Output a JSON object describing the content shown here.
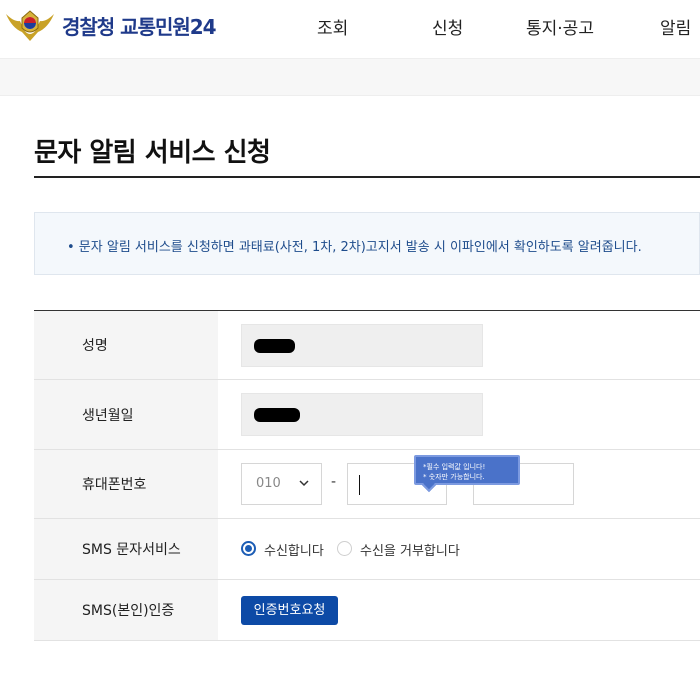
{
  "header": {
    "brand": "경찰청 교통민원24",
    "nav": [
      "조회",
      "신청",
      "통지·공고",
      "알림"
    ]
  },
  "page": {
    "title": "문자 알림 서비스 신청",
    "notice": "• 문자 알림 서비스를 신청하면 과태료(사전, 1차, 2차)고지서 발송 시 이파인에서 확인하도록 알려줍니다."
  },
  "form": {
    "name_label": "성명",
    "birth_label": "생년월일",
    "phone_label": "휴대폰번호",
    "phone_prefix": "010",
    "phone_dash": "-",
    "tooltip_line1": "*필수 입력값 입니다!",
    "tooltip_line2": "* 숫자만 가능합니다.",
    "sms_label": "SMS 문자서비스",
    "sms_yes": "수신합니다",
    "sms_no": "수신을 거부합니다",
    "sms_selected": "수신합니다",
    "auth_label": "SMS(본인)인증",
    "auth_button": "인증번호요청"
  },
  "colors": {
    "brand": "#1f3a8a",
    "accent": "#0d4aa6",
    "notice_text": "#1e4c8c",
    "tooltip_bg": "#4a72c9"
  },
  "icons": {
    "logo": "police-emblem-icon",
    "dropdown": "chevron-down-icon"
  }
}
